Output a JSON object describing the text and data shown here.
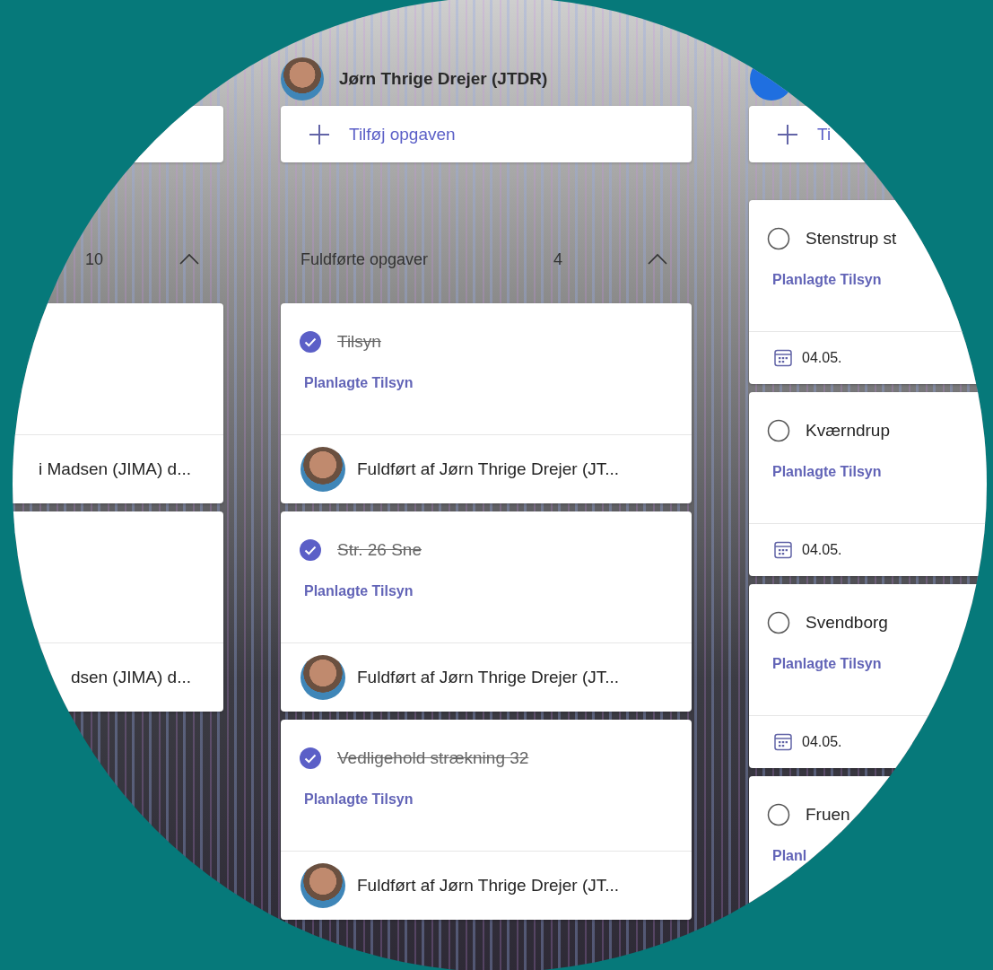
{
  "columns": [
    {
      "add_task": {
        "kind": "blank"
      },
      "bucket": {
        "count": "10",
        "expanded": true
      },
      "tasks": [
        {
          "footer": {
            "kind": "completed",
            "text": "i Madsen (JIMA) d..."
          }
        },
        {
          "footer": {
            "kind": "completed",
            "text": "dsen (JIMA) d..."
          }
        }
      ]
    },
    {
      "assignee": {
        "name": "Jørn Thrige Drejer (JTDR)",
        "kind": "photo"
      },
      "add_task": {
        "kind": "labeled",
        "label": "Tilføj opgaven"
      },
      "bucket": {
        "name": "Fuldførte opgaver",
        "count": "4",
        "expanded": true
      },
      "tasks": [
        {
          "title": "Tilsyn",
          "completed": true,
          "label": "Planlagte Tilsyn",
          "footer": {
            "kind": "completed",
            "text": "Fuldført af Jørn Thrige Drejer (JT..."
          }
        },
        {
          "title": "Str. 26 Sne",
          "completed": true,
          "label": "Planlagte Tilsyn",
          "footer": {
            "kind": "completed",
            "text": "Fuldført af Jørn Thrige Drejer (JT..."
          }
        },
        {
          "title": "Vedligehold strækning 32",
          "completed": true,
          "label": "Planlagte Tilsyn",
          "footer": {
            "kind": "completed",
            "text": "Fuldført af Jørn Thrige Drejer (JT..."
          }
        }
      ]
    },
    {
      "assignee": {
        "kind": "initials"
      },
      "add_task": {
        "kind": "labeled",
        "label": "Ti"
      },
      "tasks": [
        {
          "title": "Stenstrup st",
          "completed": false,
          "label": "Planlagte Tilsyn",
          "footer": {
            "kind": "date",
            "text": "04.05."
          }
        },
        {
          "title": "Kværndrup",
          "completed": false,
          "label": "Planlagte Tilsyn",
          "footer": {
            "kind": "date",
            "text": "04.05."
          }
        },
        {
          "title": "Svendborg",
          "completed": false,
          "label": "Planlagte Tilsyn",
          "footer": {
            "kind": "date",
            "text": "04.05."
          }
        },
        {
          "title": "Fruen",
          "completed": false,
          "label": "Planl"
        }
      ]
    }
  ]
}
